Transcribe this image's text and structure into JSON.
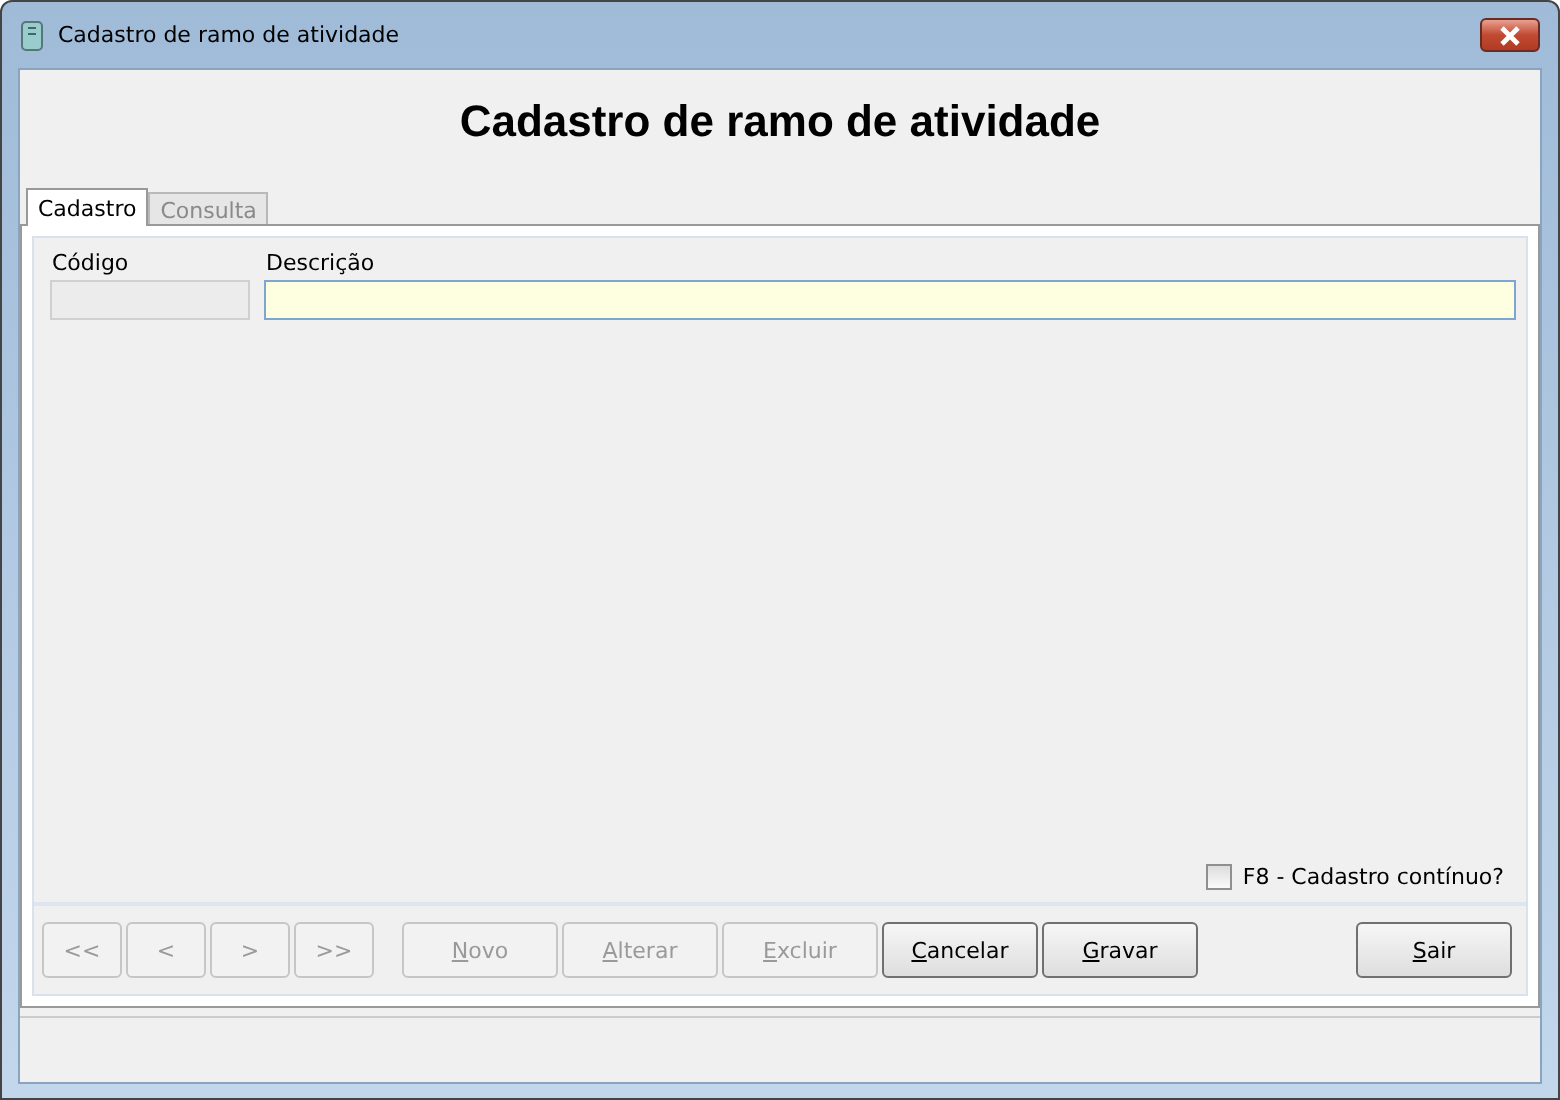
{
  "window": {
    "title": "Cadastro de ramo de atividade"
  },
  "heading": "Cadastro de ramo de atividade",
  "tabs": [
    {
      "label": "Cadastro",
      "selected": true
    },
    {
      "label": "Consulta",
      "selected": false
    }
  ],
  "fields": [
    {
      "label": "Código",
      "disabled": true
    },
    {
      "label": "Descrição",
      "disabled": false
    }
  ],
  "continuous": {
    "label": "F8 - Cadastro contínuo?",
    "checked": false
  },
  "nav_buttons": [
    {
      "label": "<<",
      "disabled": true
    },
    {
      "label": "<",
      "disabled": true
    },
    {
      "label": ">",
      "disabled": true
    },
    {
      "label": ">>",
      "disabled": true
    }
  ],
  "action_buttons": [
    {
      "label": "Novo",
      "disabled": true
    },
    {
      "label": "Alterar",
      "disabled": true
    },
    {
      "label": "Excluir",
      "disabled": true
    },
    {
      "label": "Cancelar",
      "disabled": false
    },
    {
      "label": "Gravar",
      "disabled": false
    }
  ],
  "exit_button": {
    "label": "Sair",
    "disabled": false
  }
}
